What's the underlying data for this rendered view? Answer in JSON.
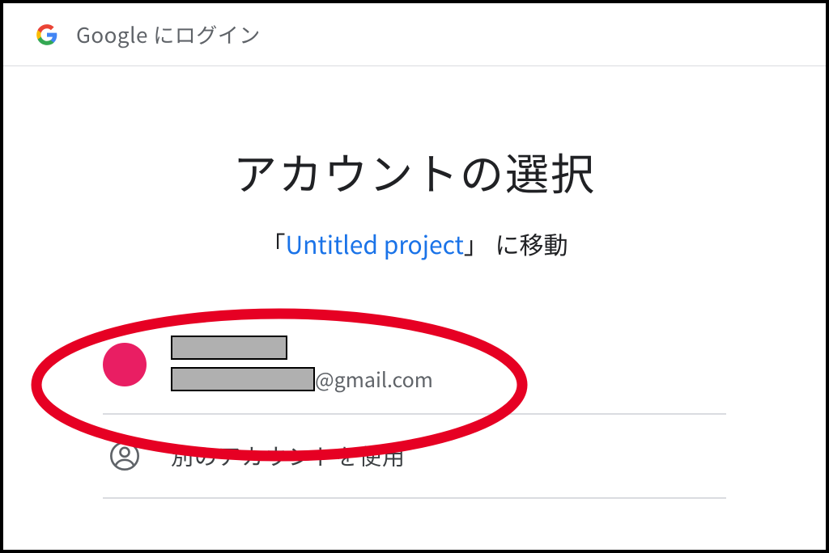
{
  "header": {
    "title": "Google にログイン"
  },
  "main": {
    "title": "アカウントの選択",
    "bracket_open": "「",
    "project_name": "Untitled project",
    "bracket_close": "」",
    "suffix": "に移動"
  },
  "accounts": [
    {
      "avatar_color": "#e91e63",
      "name_redacted": true,
      "email_domain": "@gmail.com"
    }
  ],
  "other_account": {
    "label": "別のアカウントを使用"
  },
  "annotation": {
    "highlight_color": "#e60023"
  }
}
